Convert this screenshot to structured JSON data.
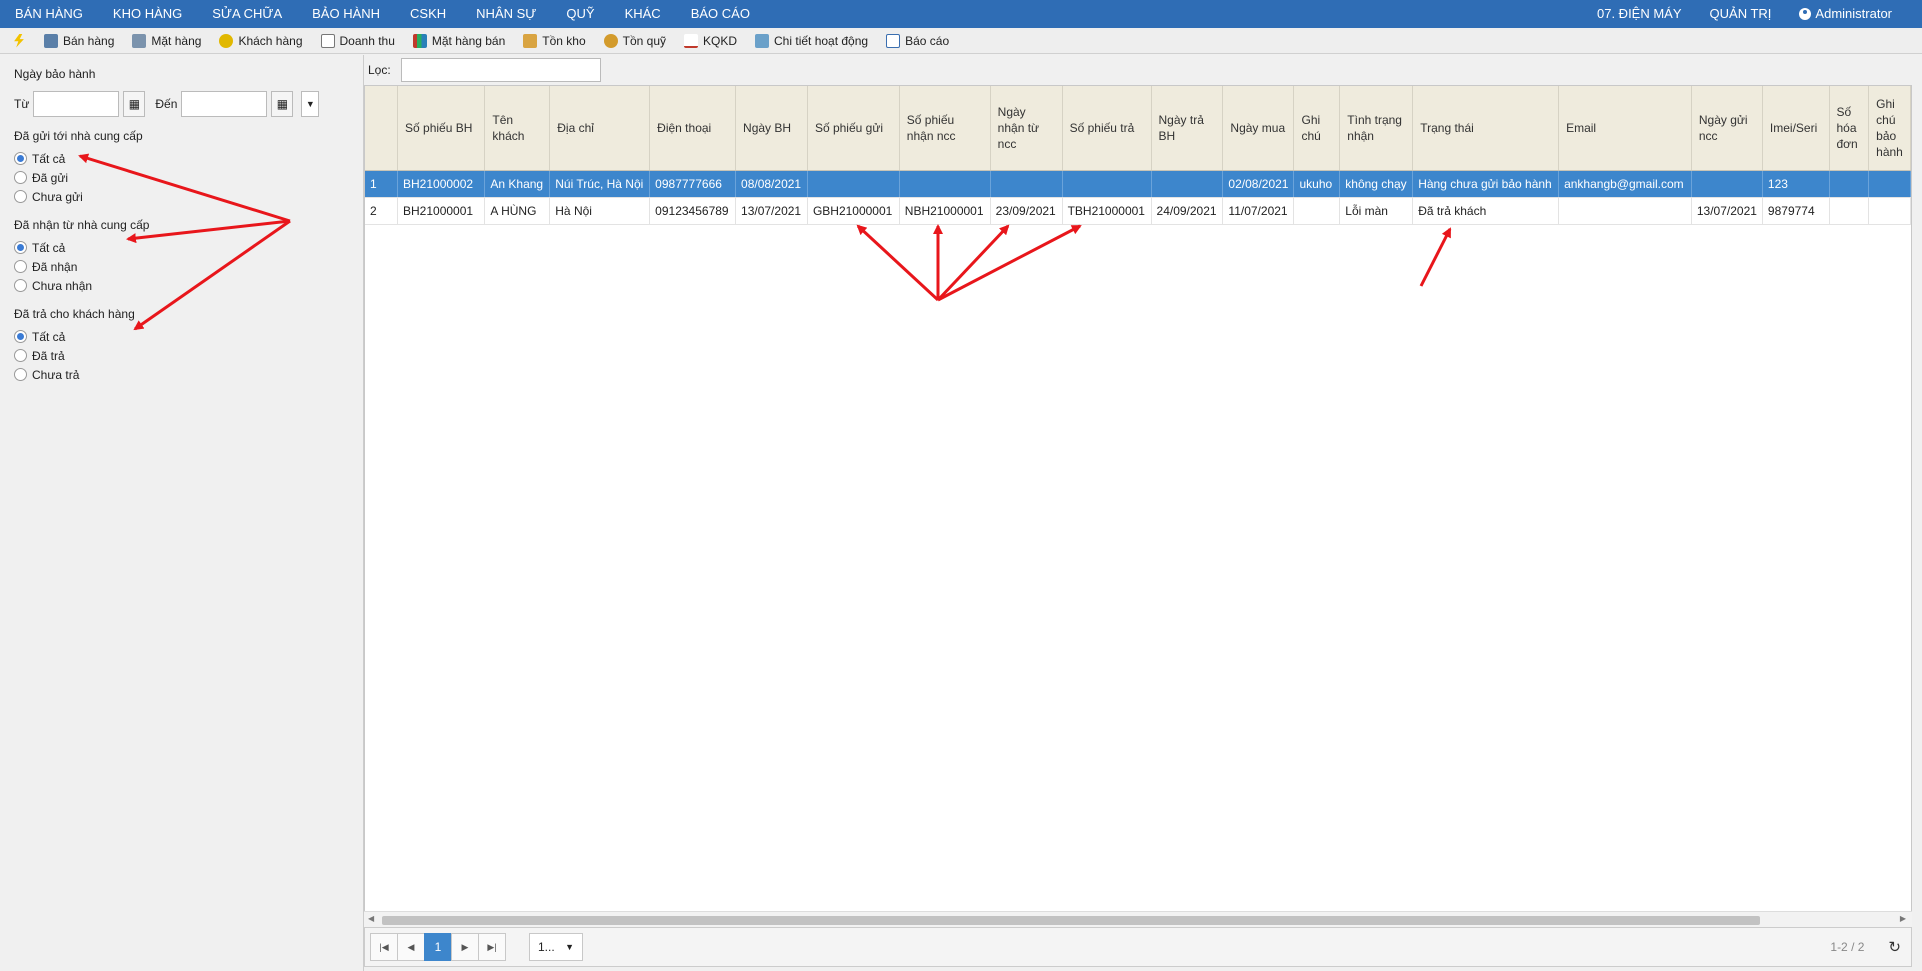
{
  "topnav": {
    "menu": [
      "BÁN HÀNG",
      "KHO HÀNG",
      "SỬA CHỮA",
      "BẢO HÀNH",
      "CSKH",
      "NHÂN SỰ",
      "QUỸ",
      "KHÁC",
      "BÁO CÁO"
    ],
    "store": "07. ĐIỆN MÁY",
    "admin": "QUẢN TRỊ",
    "user": "Administrator"
  },
  "toolbar": [
    {
      "label": "",
      "icon": "lightning-icon"
    },
    {
      "label": "Bán hàng",
      "icon": "cash-register-icon"
    },
    {
      "label": "Mặt hàng",
      "icon": "product-icon"
    },
    {
      "label": "Khách hàng",
      "icon": "customer-icon"
    },
    {
      "label": "Doanh thu",
      "icon": "revenue-icon"
    },
    {
      "label": "Mặt hàng bán",
      "icon": "bar-chart-icon"
    },
    {
      "label": "Tồn kho",
      "icon": "inventory-icon"
    },
    {
      "label": "Tồn quỹ",
      "icon": "fund-icon"
    },
    {
      "label": "KQKD",
      "icon": "line-chart-icon"
    },
    {
      "label": "Chi tiết hoạt động",
      "icon": "activity-icon"
    },
    {
      "label": "Báo cáo",
      "icon": "report-icon"
    }
  ],
  "left": {
    "date_label": "Ngày bảo hành",
    "from_label": "Từ",
    "to_label": "Đến",
    "groups": [
      {
        "title": "Đã gửi tới nhà cung cấp",
        "options": [
          "Tất cả",
          "Đã gửi",
          "Chưa gửi"
        ],
        "selected": 0
      },
      {
        "title": "Đã nhận từ nhà cung cấp",
        "options": [
          "Tất cả",
          "Đã nhận",
          "Chưa nhận"
        ],
        "selected": 0
      },
      {
        "title": "Đã trả cho khách hàng",
        "options": [
          "Tất cả",
          "Đã trả",
          "Chưa trả"
        ],
        "selected": 0
      }
    ]
  },
  "filter": {
    "label": "Lọc:",
    "value": ""
  },
  "grid": {
    "columns": [
      "",
      "Số phiếu BH",
      "Tên khách",
      "Địa chỉ",
      "Điện thoại",
      "Ngày BH",
      "Số phiếu gửi",
      "Số phiếu nhận ncc",
      "Ngày nhận từ ncc",
      "Số phiếu trả",
      "Ngày trả BH",
      "Ngày mua",
      "Ghi chú",
      "Tình trạng nhận",
      "Trạng thái",
      "Email",
      "Ngày gửi ncc",
      "Imei/Seri",
      "Số hóa đơn",
      "Ghi chú bảo hành"
    ],
    "rows": [
      [
        "1",
        "BH21000002",
        "An Khang",
        "Núi Trúc, Hà Nội",
        "0987777666",
        "08/08/2021",
        "",
        "",
        "",
        "",
        "",
        "02/08/2021",
        "ukuho",
        "không chạy",
        "Hàng chưa gửi bảo hành",
        "ankhangb@gmail.com",
        "",
        "123",
        "",
        ""
      ],
      [
        "2",
        "BH21000001",
        "A HÙNG",
        "Hà Nội",
        "09123456789",
        "13/07/2021",
        "GBH21000001",
        "NBH21000001",
        "23/09/2021",
        "TBH21000001",
        "24/09/2021",
        "11/07/2021",
        "",
        "Lỗi màn",
        "Đã trả khách",
        "",
        "13/07/2021",
        "9879774",
        "",
        ""
      ]
    ],
    "selected_row": 0
  },
  "pager": {
    "current": "1",
    "page_size": "1...",
    "info": "1-2 / 2"
  },
  "colors": {
    "nav": "#2f6db5",
    "selected": "#3d86cc",
    "header": "#efebdd",
    "arrow": "#e8161b"
  }
}
